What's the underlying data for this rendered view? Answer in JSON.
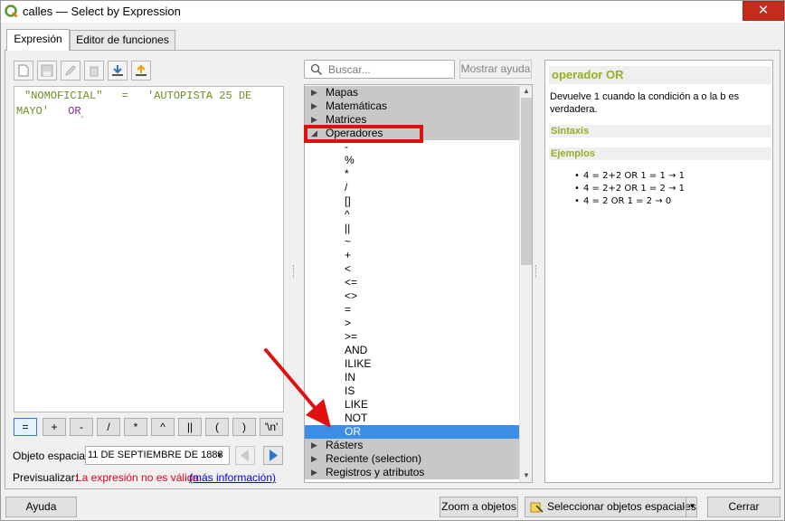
{
  "window": {
    "title": "calles — Select by Expression",
    "close_glyph": "✕"
  },
  "tabs": [
    {
      "label": "Expresión"
    },
    {
      "label": "Editor de funciones"
    }
  ],
  "toolbar": {
    "icons": [
      "new-file-icon",
      "save-icon",
      "edit-icon",
      "delete-icon",
      "import-icon",
      "export-icon"
    ]
  },
  "editor": {
    "field": "\"NOMOFICIAL\"",
    "operator": "=",
    "string_part1": "'AUTOPISTA 25 DE",
    "string_part2": "MAYO'",
    "keyword": "OR"
  },
  "operator_buttons": [
    "=",
    "+",
    "-",
    "/",
    "*",
    "^",
    "||",
    "(",
    ")",
    "'\\n'"
  ],
  "feature": {
    "label": "Objeto espacial",
    "value": "11 DE SEPTIEMBRE DE 1888"
  },
  "preview": {
    "label": "Previsualizar:",
    "error": "La expresión no es válida",
    "link": "(más información)"
  },
  "search": {
    "placeholder": "Buscar..."
  },
  "help_button": "Mostrar ayuda",
  "tree": {
    "groups_top": [
      "Mapas",
      "Matemáticas",
      "Matrices"
    ],
    "expanded_group": "Operadores",
    "operators": [
      "-",
      "%",
      "*",
      "/",
      "[]",
      "^",
      "||",
      "~",
      "+",
      "<",
      "<=",
      "<>",
      "=",
      ">",
      ">=",
      "AND",
      "ILIKE",
      "IN",
      "IS",
      "LIKE",
      "NOT",
      "OR"
    ],
    "selected": "OR",
    "groups_bottom": [
      "Rásters",
      "Reciente (selection)",
      "Registros y atributos"
    ]
  },
  "help_panel": {
    "title": "operador OR",
    "description": "Devuelve 1 cuando la condición a o la b es verdadera.",
    "syntax_heading": "Sintaxis",
    "examples_heading": "Ejemplos",
    "examples": [
      "4 = 2+2 OR 1 = 1 → 1",
      "4 = 2+2 OR 1 = 2 → 1",
      "4 = 2 OR 1 = 2 → 0"
    ]
  },
  "buttons": {
    "help": "Ayuda",
    "zoom": "Zoom a objetos",
    "select": "Seleccionar objetos espaciales",
    "close": "Cerrar"
  },
  "colors": {
    "accent_green": "#93b023",
    "selection_blue": "#3a8ee6",
    "annotation_red": "#e01010",
    "error_red": "#e0001b"
  }
}
